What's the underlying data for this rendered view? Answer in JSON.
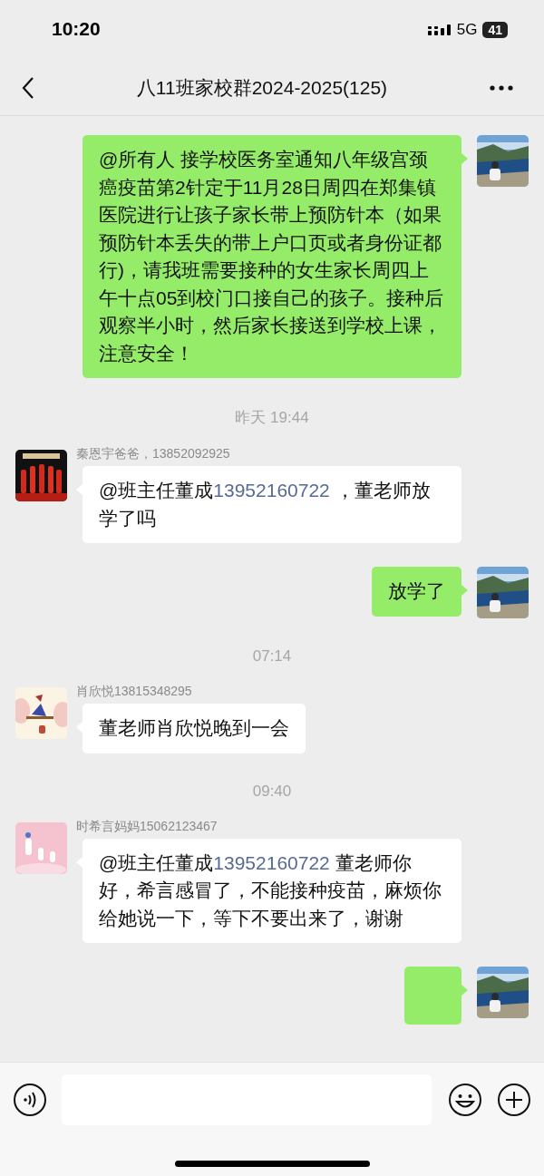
{
  "status_bar": {
    "time": "10:20",
    "network": "5G",
    "battery": "41"
  },
  "header": {
    "title": "八11班家校群2024-2025(125)"
  },
  "messages": [
    {
      "kind": "message",
      "outgoing": true,
      "parts": [
        {
          "kind": "text",
          "text": "@所有人 接学校医务室通知八年级宫颈癌疫苗第2针定于11月28日周四在郑集镇医院进行让孩子家长带上预防针本（如果预防针本丢失的带上户口页或者身份证都行)，请我班需要接种的女生家长周四上午十点05到校门口接自己的孩子。接种后观察半小时，然后家长接送到学校上课，注意安全！"
        }
      ]
    },
    {
      "kind": "time",
      "text": "昨天 19:44"
    },
    {
      "kind": "message",
      "outgoing": false,
      "sender": "秦恩宇爸爸，13852092925",
      "parts": [
        {
          "kind": "text",
          "text": "@班主任董成"
        },
        {
          "kind": "phone",
          "text": "13952160722"
        },
        {
          "kind": "text",
          "text": " ，董老师放学了吗"
        }
      ]
    },
    {
      "kind": "message",
      "outgoing": true,
      "parts": [
        {
          "kind": "text",
          "text": "放学了"
        }
      ]
    },
    {
      "kind": "time",
      "text": "07:14"
    },
    {
      "kind": "message",
      "outgoing": false,
      "sender": "肖欣悦13815348295",
      "parts": [
        {
          "kind": "text",
          "text": "董老师肖欣悦晚到一会"
        }
      ]
    },
    {
      "kind": "time",
      "text": "09:40"
    },
    {
      "kind": "message",
      "outgoing": false,
      "sender": "时希言妈妈15062123467",
      "parts": [
        {
          "kind": "text",
          "text": "@班主任董成"
        },
        {
          "kind": "phone",
          "text": "13952160722"
        },
        {
          "kind": "text",
          "text": " 董老师你好，希言感冒了，不能接种疫苗，麻烦你给她说一下，等下不要出来了，谢谢"
        }
      ]
    },
    {
      "kind": "message",
      "outgoing": true
    }
  ]
}
